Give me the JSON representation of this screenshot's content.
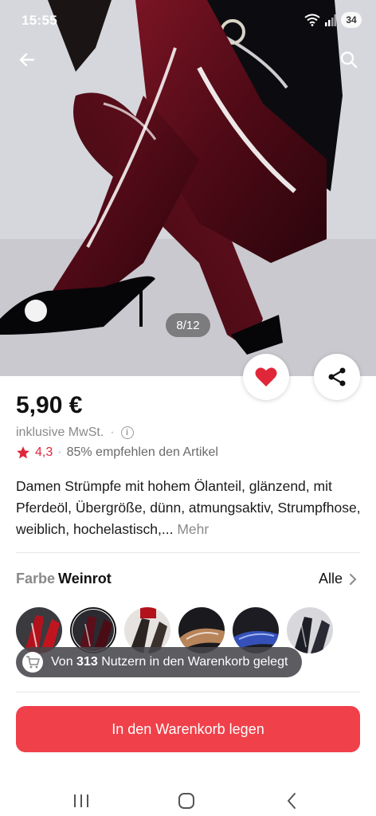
{
  "status_bar": {
    "time": "15:55",
    "battery": "34"
  },
  "gallery": {
    "counter": "8/12"
  },
  "product": {
    "price": "5,90 €",
    "tax_note": "inklusive MwSt.",
    "rating": "4,3",
    "recommend_text": "85% empfehlen den Artikel",
    "description": "Damen Strümpfe mit hohem Ölanteil, glänzend, mit Pferdeöl, Übergröße, dünn, atmungsaktiv, Strumpfhose, weiblich, hochelastisch,...",
    "more_label": "Mehr"
  },
  "color_selector": {
    "label": "Farbe",
    "selected": "Weinrot",
    "all_label": "Alle",
    "swatches": [
      {
        "name": "red-latex",
        "color": "#b3121c"
      },
      {
        "name": "wine-red",
        "color": "#5a0f1a"
      },
      {
        "name": "black-sheer",
        "color": "#2a2422"
      },
      {
        "name": "nude-gloss",
        "color": "#b8845a"
      },
      {
        "name": "blue-gloss",
        "color": "#3550b8"
      },
      {
        "name": "black-gloss",
        "color": "#1e1e26"
      }
    ]
  },
  "social_proof": {
    "prefix": "Von",
    "count": "313",
    "suffix": "Nutzern in den Warenkorb gelegt"
  },
  "cta": {
    "label": "In den Warenkorb legen"
  },
  "colors": {
    "accent": "#f0404a",
    "rating_star": "#e0273a"
  },
  "icons": [
    "back-arrow-icon",
    "search-icon",
    "heart-icon",
    "share-icon",
    "info-icon",
    "star-icon",
    "chevron-right-icon",
    "cart-icon",
    "recents-icon",
    "home-icon",
    "nav-back-icon"
  ]
}
